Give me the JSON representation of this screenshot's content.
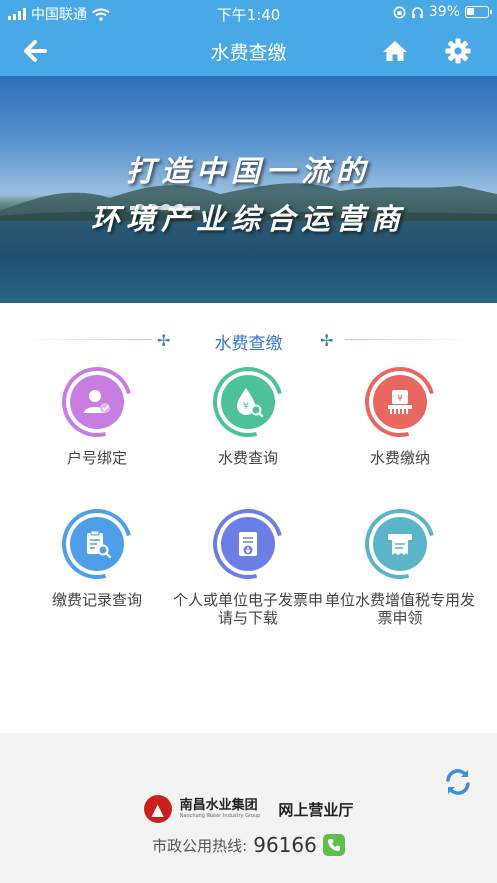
{
  "status_bar": {
    "carrier": "中国联通",
    "time": "下午1:40",
    "battery_percent": "39%",
    "battery_level": 0.39
  },
  "navbar": {
    "title": "水费查缴",
    "back_icon": "arrow-left-icon",
    "home_icon": "home-icon",
    "settings_icon": "gear-icon"
  },
  "banner": {
    "line1": "打造中国一流的",
    "line2": "环境产业综合运营商"
  },
  "section": {
    "title": "水费查缴"
  },
  "services": [
    {
      "label": "户号绑定",
      "icon": "user-bind-icon",
      "color": "#c77ee0"
    },
    {
      "label": "水费查询",
      "icon": "water-drop-search-icon",
      "color": "#4cc19a"
    },
    {
      "label": "水费缴纳",
      "icon": "payment-icon",
      "color": "#e8675f"
    },
    {
      "label": "缴费记录查询",
      "icon": "record-search-icon",
      "color": "#4f9ee8"
    },
    {
      "label": "个人或单位电子发票申请与下载",
      "icon": "invoice-download-icon",
      "color": "#6a7ee6"
    },
    {
      "label": "单位水费增值税专用发票申领",
      "icon": "vat-invoice-icon",
      "color": "#5cb4c8"
    }
  ],
  "footer": {
    "refresh_icon": "refresh-icon",
    "company_cn": "南昌水业集团",
    "company_en": "Nanchang Water Industry Group",
    "hall": "网上营业厅",
    "hotline_label": "市政公用热线:",
    "hotline_number": "96166",
    "phone_icon": "phone-icon"
  }
}
